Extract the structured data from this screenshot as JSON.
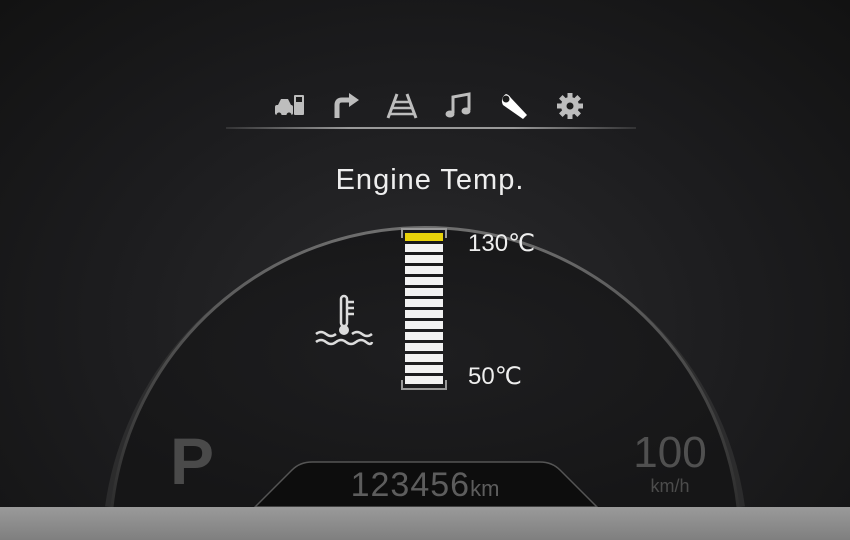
{
  "menu": {
    "items": [
      {
        "icon": "car-fuel-icon",
        "active": false
      },
      {
        "icon": "turn-right-arrow-icon",
        "active": false
      },
      {
        "icon": "lane-road-icon",
        "active": false
      },
      {
        "icon": "music-note-icon",
        "active": false
      },
      {
        "icon": "wrench-icon",
        "active": true
      },
      {
        "icon": "gear-settings-icon",
        "active": false
      }
    ]
  },
  "screen": {
    "title": "Engine Temp."
  },
  "gauge": {
    "max_label": "130℃",
    "min_label": "50℃",
    "level_fraction": 1.0,
    "segments": 14,
    "highlight_color": "#e8d20a",
    "segment_color": "#f2f2f2"
  },
  "status": {
    "gear": "P",
    "speed": "100",
    "speed_unit": "km/h",
    "odometer_value": "123456",
    "odometer_unit": "km"
  },
  "colors": {
    "accent_yellow": "#e8d20a",
    "text_white": "#eeeeee",
    "icon_gray": "#bdbdbd"
  }
}
